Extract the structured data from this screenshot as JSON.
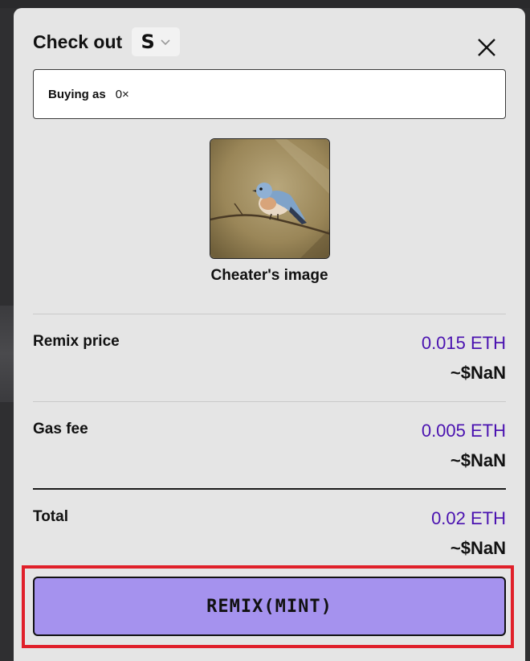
{
  "header": {
    "title": "Check out",
    "network_symbol": "S"
  },
  "buyer": {
    "label": "Buying as",
    "address": "0×"
  },
  "artwork": {
    "title": "Cheater's image"
  },
  "rows": [
    {
      "label": "Remix price",
      "eth": "0.015 ETH",
      "usd": "~$NaN"
    },
    {
      "label": "Gas fee",
      "eth": "0.005 ETH",
      "usd": "~$NaN"
    },
    {
      "label": "Total",
      "eth": "0.02 ETH",
      "usd": "~$NaN"
    }
  ],
  "action": {
    "label": "REMIX(MINT)"
  },
  "colors": {
    "accent_price": "#4a12b0",
    "button_bg": "#a592ee",
    "highlight": "#e0202a",
    "modal_bg": "#e5e5e5"
  }
}
